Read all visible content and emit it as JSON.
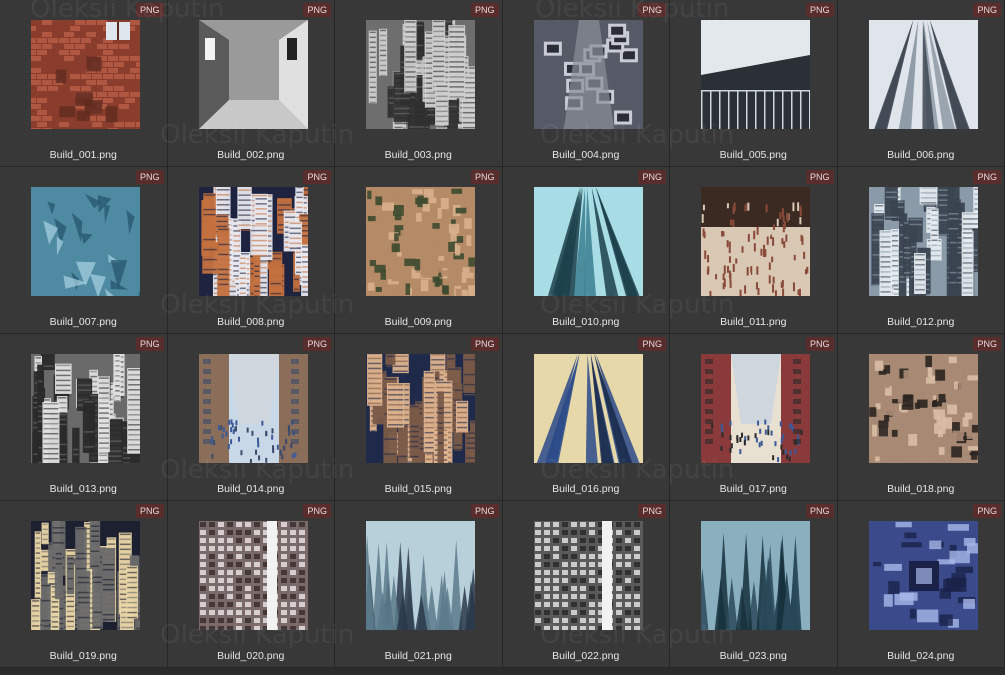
{
  "watermark": "Oleksii Kaputin",
  "badge_label": "PNG",
  "files": [
    {
      "name": "Build_001.png",
      "thumb": "brick",
      "colors": [
        "#8a3d2c",
        "#b35a43",
        "#5e2a1f"
      ]
    },
    {
      "name": "Build_002.png",
      "thumb": "room",
      "colors": [
        "#7a7a7a",
        "#c8c8c8",
        "#3a3a3a"
      ]
    },
    {
      "name": "Build_003.png",
      "thumb": "towers",
      "colors": [
        "#6e6e6e",
        "#cfcfcf",
        "#2f2f2f"
      ]
    },
    {
      "name": "Build_004.png",
      "thumb": "machines",
      "colors": [
        "#555a66",
        "#c9ccd6",
        "#2a2d36"
      ]
    },
    {
      "name": "Build_005.png",
      "thumb": "hall",
      "colors": [
        "#9aaab3",
        "#e3e8ec",
        "#3d4a52"
      ]
    },
    {
      "name": "Build_006.png",
      "thumb": "skyward",
      "colors": [
        "#8e9aa6",
        "#dfe5ea",
        "#3e4852"
      ]
    },
    {
      "name": "Build_007.png",
      "thumb": "crystal",
      "colors": [
        "#4f8aa3",
        "#a9d3e2",
        "#23536a"
      ]
    },
    {
      "name": "Build_008.png",
      "thumb": "towers",
      "colors": [
        "#1e2340",
        "#e8e8ee",
        "#c4713f"
      ]
    },
    {
      "name": "Build_009.png",
      "thumb": "mosaic",
      "colors": [
        "#b58a67",
        "#3d4a30",
        "#d9b08d"
      ]
    },
    {
      "name": "Build_010.png",
      "thumb": "skyward",
      "colors": [
        "#3c7f8f",
        "#a8dde6",
        "#1c3f4a"
      ]
    },
    {
      "name": "Build_011.png",
      "thumb": "crowd",
      "colors": [
        "#d8c8b4",
        "#3a2a22",
        "#8a4a3a"
      ]
    },
    {
      "name": "Build_012.png",
      "thumb": "towers",
      "colors": [
        "#8a9aa8",
        "#e6ecf0",
        "#3a4450"
      ]
    },
    {
      "name": "Build_013.png",
      "thumb": "towers",
      "colors": [
        "#6a6a6a",
        "#e2e2e2",
        "#2a2a2a"
      ]
    },
    {
      "name": "Build_014.png",
      "thumb": "street",
      "colors": [
        "#8a6e5a",
        "#c9d8e6",
        "#3a4a6a"
      ]
    },
    {
      "name": "Build_015.png",
      "thumb": "towers",
      "colors": [
        "#1f2a4a",
        "#e0b48e",
        "#7a5a48"
      ]
    },
    {
      "name": "Build_016.png",
      "thumb": "skyward",
      "colors": [
        "#2a4a8a",
        "#e6d8a8",
        "#1a2a4a"
      ]
    },
    {
      "name": "Build_017.png",
      "thumb": "street",
      "colors": [
        "#8a3a3a",
        "#e8e0d0",
        "#2a2a2a"
      ]
    },
    {
      "name": "Build_018.png",
      "thumb": "mosaic",
      "colors": [
        "#a88a74",
        "#2a2420",
        "#d8bca4"
      ]
    },
    {
      "name": "Build_019.png",
      "thumb": "towers",
      "colors": [
        "#1c2030",
        "#ecd8a8",
        "#6a6a6a"
      ]
    },
    {
      "name": "Build_020.png",
      "thumb": "facade",
      "colors": [
        "#7a6a6a",
        "#e8e0e0",
        "#3a2e2e"
      ]
    },
    {
      "name": "Build_021.png",
      "thumb": "spikes",
      "colors": [
        "#5a7a8a",
        "#b8d0da",
        "#2a3a4a"
      ]
    },
    {
      "name": "Build_022.png",
      "thumb": "facade",
      "colors": [
        "#5a5a5a",
        "#e0e0e0",
        "#2a2a2a"
      ]
    },
    {
      "name": "Build_023.png",
      "thumb": "spikes",
      "colors": [
        "#2a4a5a",
        "#8ab0c0",
        "#16303c"
      ]
    },
    {
      "name": "Build_024.png",
      "thumb": "scifi",
      "colors": [
        "#3a4a8a",
        "#a8b8e8",
        "#1a2248"
      ]
    }
  ]
}
